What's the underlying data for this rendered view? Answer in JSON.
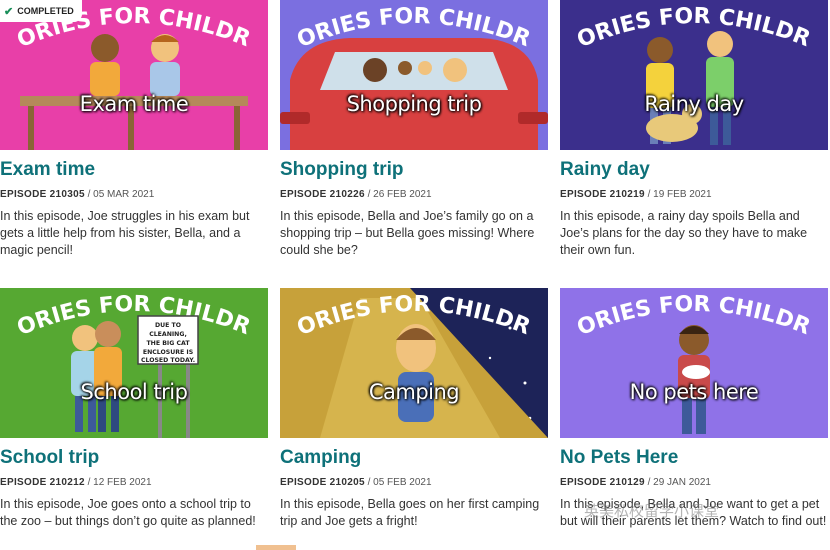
{
  "badge": {
    "label": "COMPLETED"
  },
  "banner_text": "STORIES FOR CHILDREN",
  "watermark": "英美私校留学小课堂",
  "episodes": [
    {
      "title": "Exam time",
      "thumb_title": "Exam time",
      "episode": "EPISODE 210305",
      "date": "05 MAR 2021",
      "description": "In this episode, Joe struggles in his exam but gets a little help from his sister, Bella, and a magic pencil!",
      "bg": "#e83fa8"
    },
    {
      "title": "Shopping trip",
      "thumb_title": "Shopping trip",
      "episode": "EPISODE 210226",
      "date": "26 FEB 2021",
      "description": "In this episode, Bella and Joe’s family go on a shopping trip – but Bella goes missing! Where could she be?",
      "bg": "#7b6fe0"
    },
    {
      "title": "Rainy day",
      "thumb_title": "Rainy day",
      "episode": "EPISODE 210219",
      "date": "19 FEB 2021",
      "description": "In this episode, a rainy day spoils Bella and Joe’s plans for the day so they have to make their own fun.",
      "bg": "#3b2f8c"
    },
    {
      "title": "School trip",
      "thumb_title": "School trip",
      "episode": "EPISODE 210212",
      "date": "12 FEB 2021",
      "description": "In this episode, Joe goes onto a school trip to the zoo – but things don’t go quite as planned!",
      "bg": "#56a832",
      "sign": [
        "DUE TO",
        "CLEANING,",
        "THE BIG CAT",
        "ENCLOSURE IS",
        "CLOSED TODAY."
      ]
    },
    {
      "title": "Camping",
      "thumb_title": "Camping",
      "episode": "EPISODE 210205",
      "date": "05 FEB 2021",
      "description": "In this episode, Bella goes on her first camping trip and Joe gets a fright!",
      "bg": "#1d2358"
    },
    {
      "title": "No Pets Here",
      "thumb_title": "No pets here",
      "episode": "EPISODE 210129",
      "date": "29 JAN 2021",
      "description": "In this episode, Bella and Joe want to get a pet but will their parents let them? Watch to find out!",
      "bg": "#8f72e8"
    }
  ]
}
